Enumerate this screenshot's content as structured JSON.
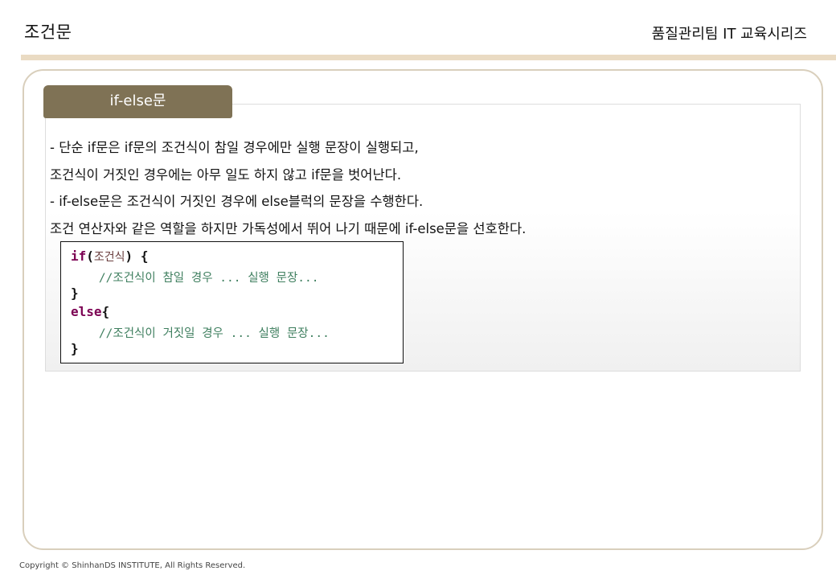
{
  "header": {
    "title": "조건문",
    "series": "품질관리팀 IT 교육시리즈"
  },
  "section": {
    "tab_label": "if-else문"
  },
  "description": [
    "- 단순 if문은 if문의 조건식이 참일 경우에만 실행 문장이 실행되고,",
    "  조건식이 거짓인 경우에는 아무 일도 하지 않고 if문을 벗어난다.",
    "- if-else문은 조건식이 거짓인 경우에 else블럭의 문장을 수행한다.",
    "  조건 연산자와 같은 역할을 하지만 가독성에서 뛰어 나기 때문에 if-else문을 선호한다."
  ],
  "code": {
    "if_keyword": "if",
    "open_paren": "(",
    "condition": "조건식",
    "close_paren_brace": ") {",
    "comment_true": "    //조건식이 참일 경우 ... 실행 문장...",
    "close_brace_1": "}",
    "else_keyword": "else",
    "else_brace": "{",
    "comment_false": "    //조건식이 거짓일 경우 ... 실행 문장...",
    "close_brace_2": "}"
  },
  "footer": {
    "copyright": "Copyright © ShinhanDS INSTITUTE, All Rights Reserved."
  },
  "colors": {
    "tab_background": "#7f7255",
    "header_rule": "#eadbc3",
    "frame_border": "#d9cfbc",
    "keyword": "#7b0052",
    "comment": "#3f7f5f"
  }
}
